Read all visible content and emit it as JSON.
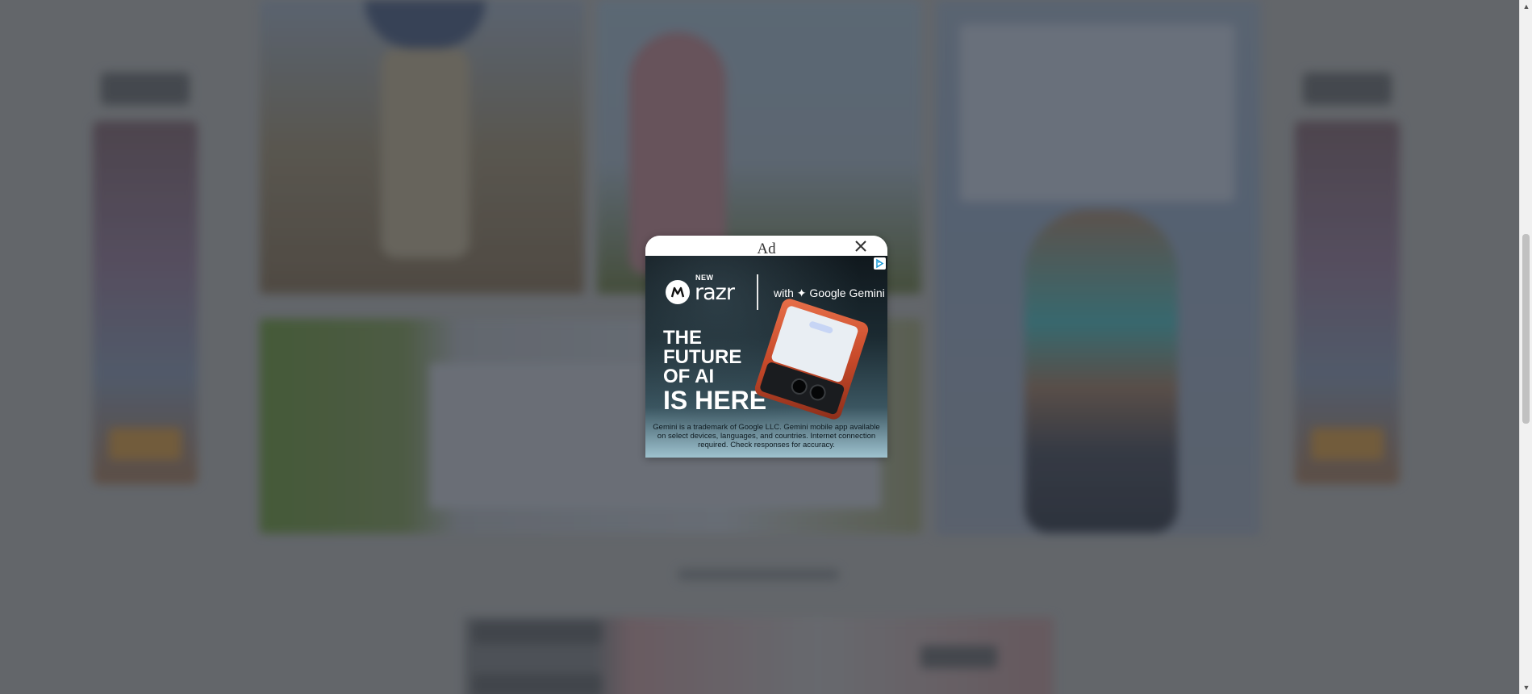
{
  "ad": {
    "label": "Ad",
    "close_icon": "close-icon",
    "adchoices_icon": "adchoices-icon",
    "brand_new": "NEW",
    "brand_product": "razr",
    "brand_tagline": "with ✦ Google Gemini",
    "headline_line1": "THE",
    "headline_line2": "FUTURE",
    "headline_line3": "OF AI",
    "headline_line4": "IS HERE",
    "disclaimer": "Gemini is a trademark of Google LLC. Gemini mobile app available on select devices, languages, and countries. Internet connection required. Check responses for accuracy."
  },
  "scrollbar": {
    "up_icon": "scroll-up-arrow-icon",
    "down_icon": "scroll-down-arrow-icon"
  }
}
